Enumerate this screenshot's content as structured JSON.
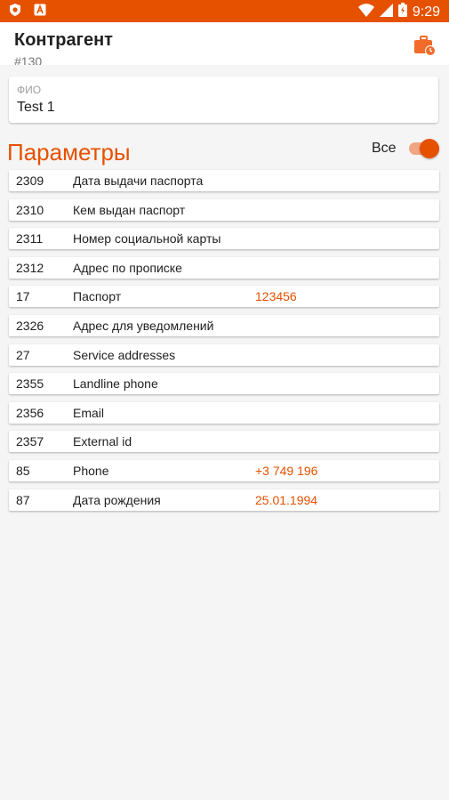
{
  "status_bar": {
    "time": "9:29",
    "bar_color": "#e65100",
    "icons": [
      "shield-icon",
      "a-box-icon",
      "wifi-icon",
      "signal-icon",
      "battery-icon"
    ]
  },
  "app_bar": {
    "title": "Контрагент",
    "subtitle": "#130",
    "action_icon": "briefcase-clock-icon"
  },
  "fio": {
    "label": "ФИО",
    "value": "Test 1"
  },
  "params_section": {
    "title": "Параметры",
    "all_label": "Все",
    "all_toggle_on": true,
    "accent_color": "#e65100"
  },
  "params": [
    {
      "id": "2309",
      "name": "Дата выдачи паспорта",
      "value": ""
    },
    {
      "id": "2310",
      "name": "Кем выдан паспорт",
      "value": ""
    },
    {
      "id": "2311",
      "name": "Номер социальной карты",
      "value": ""
    },
    {
      "id": "2312",
      "name": "Адрес по прописке",
      "value": ""
    },
    {
      "id": "17",
      "name": "Паспорт",
      "value": "123456"
    },
    {
      "id": "2326",
      "name": "Адрес для уведомлений",
      "value": ""
    },
    {
      "id": "27",
      "name": "Service addresses",
      "value": ""
    },
    {
      "id": "2355",
      "name": "Landline phone",
      "value": ""
    },
    {
      "id": "2356",
      "name": "Email",
      "value": ""
    },
    {
      "id": "2357",
      "name": "External id",
      "value": ""
    },
    {
      "id": "85",
      "name": "Phone",
      "value": "+3 749 196"
    },
    {
      "id": "87",
      "name": "Дата рождения",
      "value": "25.01.1994"
    }
  ]
}
